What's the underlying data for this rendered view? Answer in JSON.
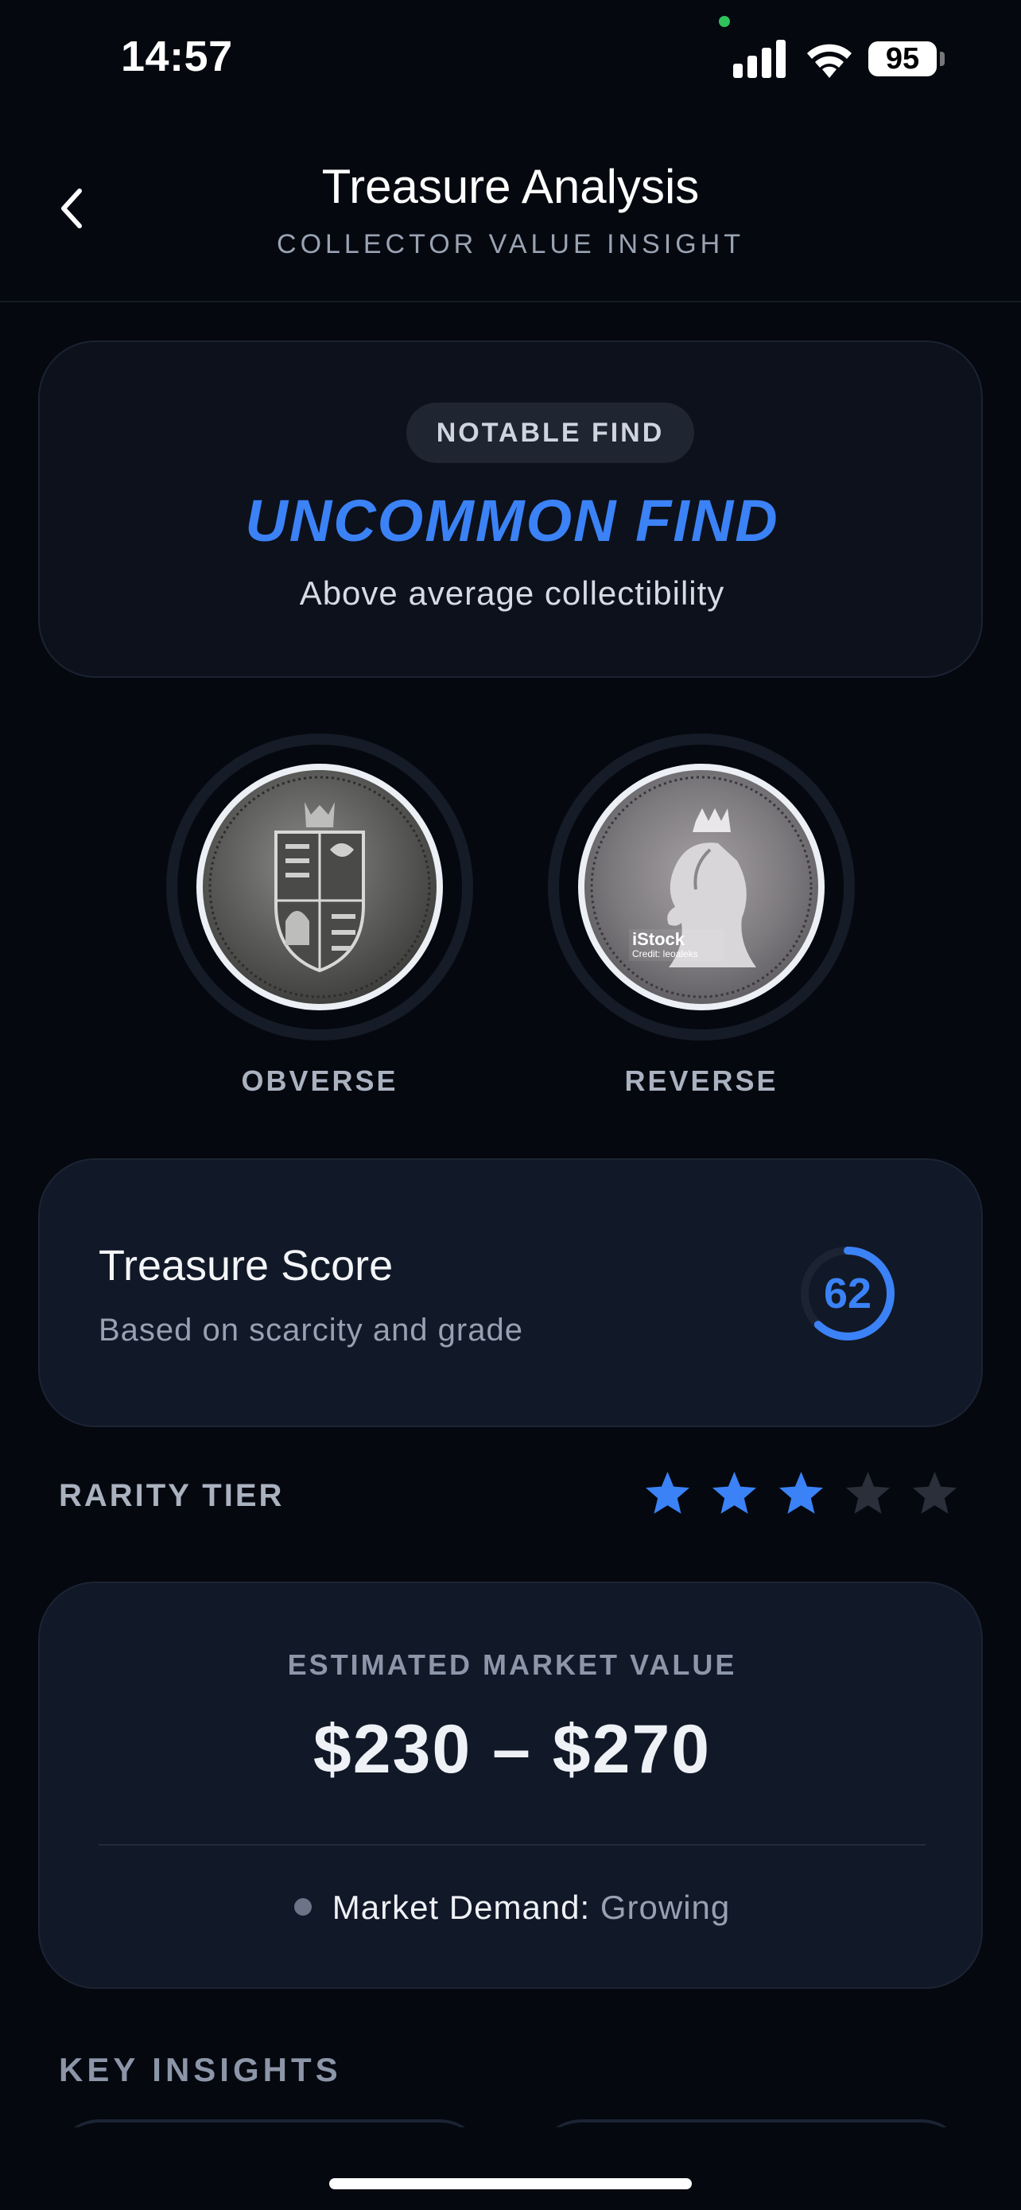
{
  "status_bar": {
    "time": "14:57",
    "battery": "95",
    "icons": [
      "signal-icon",
      "wifi-icon",
      "battery-icon"
    ]
  },
  "header": {
    "title": "Treasure Analysis",
    "subtitle": "COLLECTOR VALUE INSIGHT",
    "back_icon": "chevron-left-icon"
  },
  "find_card": {
    "badge": "NOTABLE FIND",
    "title": "UNCOMMON FIND",
    "description": "Above average collectibility",
    "accent_color": "#3b82f6"
  },
  "coins": {
    "obverse_label": "OBVERSE",
    "reverse_label": "REVERSE",
    "reverse_watermark": "iStock",
    "reverse_watermark_credit": "Credit: leoaleks"
  },
  "score_card": {
    "title": "Treasure Score",
    "subtitle": "Based on scarcity and grade",
    "score": "62",
    "score_fraction": 0.62
  },
  "rarity_tier": {
    "label": "RARITY TIER",
    "stars_filled": 3,
    "stars_total": 5,
    "filled_color": "#3b82f6",
    "empty_color": "#2a2f3a"
  },
  "value_card": {
    "label": "ESTIMATED MARKET VALUE",
    "range": "$230 – $270",
    "demand_label": "Market Demand:",
    "demand_value": "Growing"
  },
  "insights": {
    "heading": "KEY INSIGHTS"
  }
}
